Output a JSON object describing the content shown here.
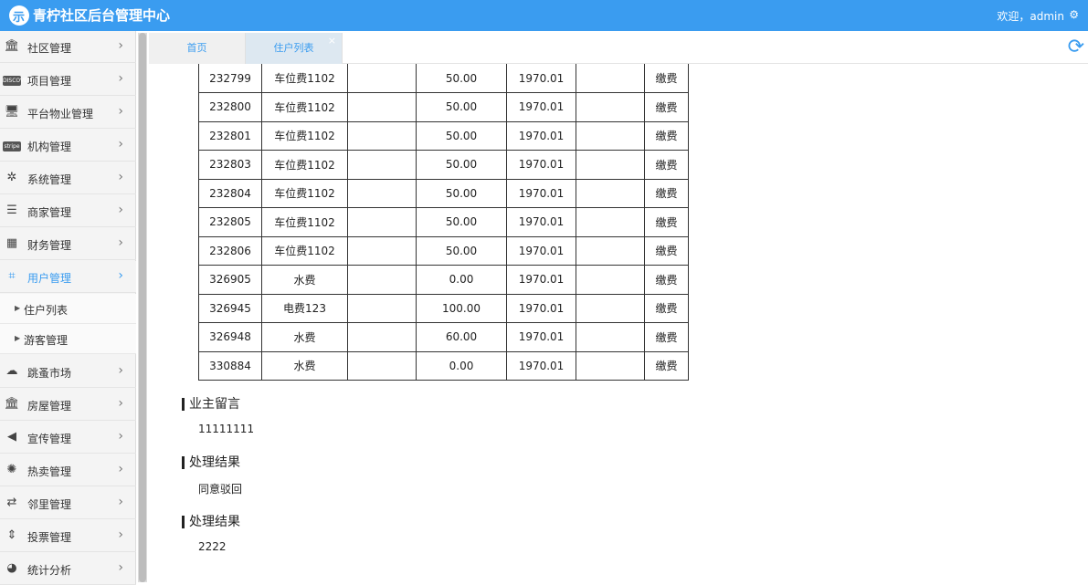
{
  "header": {
    "app_title": "青柠社区后台管理中心",
    "welcome": "欢迎，admin",
    "settings_glyph": "⚙"
  },
  "sidebar": {
    "items": [
      {
        "label": "社区管理",
        "icon": "bank-icon",
        "glyph": "🏛"
      },
      {
        "label": "项目管理",
        "icon": "discover-card-icon",
        "glyph": "DISCOVER"
      },
      {
        "label": "平台物业管理",
        "icon": "desktop-icon",
        "glyph": "🖥"
      },
      {
        "label": "机构管理",
        "icon": "stripe-icon",
        "glyph": "stripe"
      },
      {
        "label": "系统管理",
        "icon": "yelp-icon",
        "glyph": "✲"
      },
      {
        "label": "商家管理",
        "icon": "bars-icon",
        "glyph": "☰"
      },
      {
        "label": "财务管理",
        "icon": "calculator-icon",
        "glyph": "▦"
      },
      {
        "label": "用户管理",
        "icon": "crop-icon",
        "glyph": "⌗",
        "active": true
      },
      {
        "label": "跳蚤市场",
        "icon": "cloud-icon",
        "glyph": "☁"
      },
      {
        "label": "房屋管理",
        "icon": "bank-icon",
        "glyph": "🏛"
      },
      {
        "label": "宣传管理",
        "icon": "volume-icon",
        "glyph": "◀"
      },
      {
        "label": "热卖管理",
        "icon": "sun-icon",
        "glyph": "✺"
      },
      {
        "label": "邻里管理",
        "icon": "retweet-icon",
        "glyph": "⇄"
      },
      {
        "label": "投票管理",
        "icon": "sort-icon",
        "glyph": "⇕"
      },
      {
        "label": "统计分析",
        "icon": "pie-chart-icon",
        "glyph": "◕"
      }
    ],
    "subitems": [
      {
        "label": "住户列表"
      },
      {
        "label": "游客管理"
      }
    ],
    "arrow": "›"
  },
  "tabs": [
    {
      "label": "首页"
    },
    {
      "label": "住户列表",
      "close": "×"
    }
  ],
  "refresh_glyph": "⟳",
  "fees_table": {
    "action_label": "缴费",
    "rows": [
      {
        "id": "232799",
        "name": "车位费1102",
        "blank1": "",
        "amount": "50.00",
        "date": "1970.01",
        "blank2": ""
      },
      {
        "id": "232800",
        "name": "车位费1102",
        "blank1": "",
        "amount": "50.00",
        "date": "1970.01",
        "blank2": ""
      },
      {
        "id": "232801",
        "name": "车位费1102",
        "blank1": "",
        "amount": "50.00",
        "date": "1970.01",
        "blank2": ""
      },
      {
        "id": "232803",
        "name": "车位费1102",
        "blank1": "",
        "amount": "50.00",
        "date": "1970.01",
        "blank2": ""
      },
      {
        "id": "232804",
        "name": "车位费1102",
        "blank1": "",
        "amount": "50.00",
        "date": "1970.01",
        "blank2": ""
      },
      {
        "id": "232805",
        "name": "车位费1102",
        "blank1": "",
        "amount": "50.00",
        "date": "1970.01",
        "blank2": ""
      },
      {
        "id": "232806",
        "name": "车位费1102",
        "blank1": "",
        "amount": "50.00",
        "date": "1970.01",
        "blank2": ""
      },
      {
        "id": "326905",
        "name": "水费",
        "blank1": "",
        "amount": "0.00",
        "date": "1970.01",
        "blank2": ""
      },
      {
        "id": "326945",
        "name": "电费123",
        "blank1": "",
        "amount": "100.00",
        "date": "1970.01",
        "blank2": ""
      },
      {
        "id": "326948",
        "name": "水费",
        "blank1": "",
        "amount": "60.00",
        "date": "1970.01",
        "blank2": ""
      },
      {
        "id": "330884",
        "name": "水费",
        "blank1": "",
        "amount": "0.00",
        "date": "1970.01",
        "blank2": ""
      }
    ]
  },
  "sections": [
    {
      "title": "业主留言",
      "value": "11111111"
    },
    {
      "title": "处理结果",
      "value": "同意驳回"
    },
    {
      "title": "处理结果",
      "value": "2222"
    }
  ]
}
